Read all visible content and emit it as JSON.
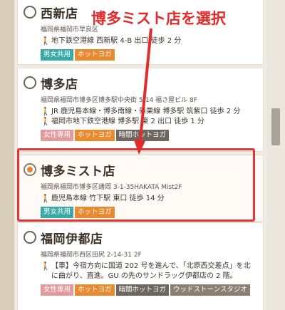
{
  "annotation": {
    "text": "博多ミスト店を選択",
    "color": "#e42b2b"
  },
  "stores": [
    {
      "name": "西新店",
      "address": "福岡県福岡市早良区",
      "access": [
        "地下鉄空港線 西新駅 4-B 出口 徒歩 2 分"
      ],
      "tags": [
        {
          "label": "男女共用",
          "color": "teal"
        },
        {
          "label": "ホットヨガ",
          "color": "orange"
        }
      ]
    },
    {
      "name": "博多店",
      "address": "福岡県福岡市博多区博多駅中央街 5-14 福さ屋ビル 8F",
      "access": [
        "JR 鹿児島本線・博多南線・篠栗線 博多駅 筑紫口 徒歩 2 分",
        "福岡市地下鉄空港線 博多駅 東 2 出口 徒歩 1 分"
      ],
      "tags": [
        {
          "label": "女性専用",
          "color": "pink"
        },
        {
          "label": "ホットヨガ",
          "color": "orange"
        },
        {
          "label": "暗闇ホットヨガ",
          "color": "dark"
        }
      ]
    },
    {
      "name": "博多ミスト店",
      "address": "福岡県福岡市博多区諸岡 3-1-35HAKATA Mist2F",
      "access": [
        "鹿児島本線 竹下駅 東口 徒歩 14 分"
      ],
      "tags": [
        {
          "label": "男女共用",
          "color": "teal"
        },
        {
          "label": "ホットヨガ",
          "color": "orange"
        }
      ],
      "selected": true
    },
    {
      "name": "福岡伊都店",
      "address": "福岡県福岡市西区田尻 2-14-31 2F",
      "access": [
        "【車】今宿方向に国道 202 号を進んで、「北原西交差点」を北に曲がり、直進。GU の先のサンドラッグ伊都店の 2 階。"
      ],
      "tags": [
        {
          "label": "女性専用",
          "color": "pink"
        },
        {
          "label": "ホットヨガ",
          "color": "orange"
        },
        {
          "label": "暗闇ホットヨガ",
          "color": "dark"
        },
        {
          "label": "ウッドストーンスタジオ",
          "color": "brown"
        }
      ]
    }
  ]
}
